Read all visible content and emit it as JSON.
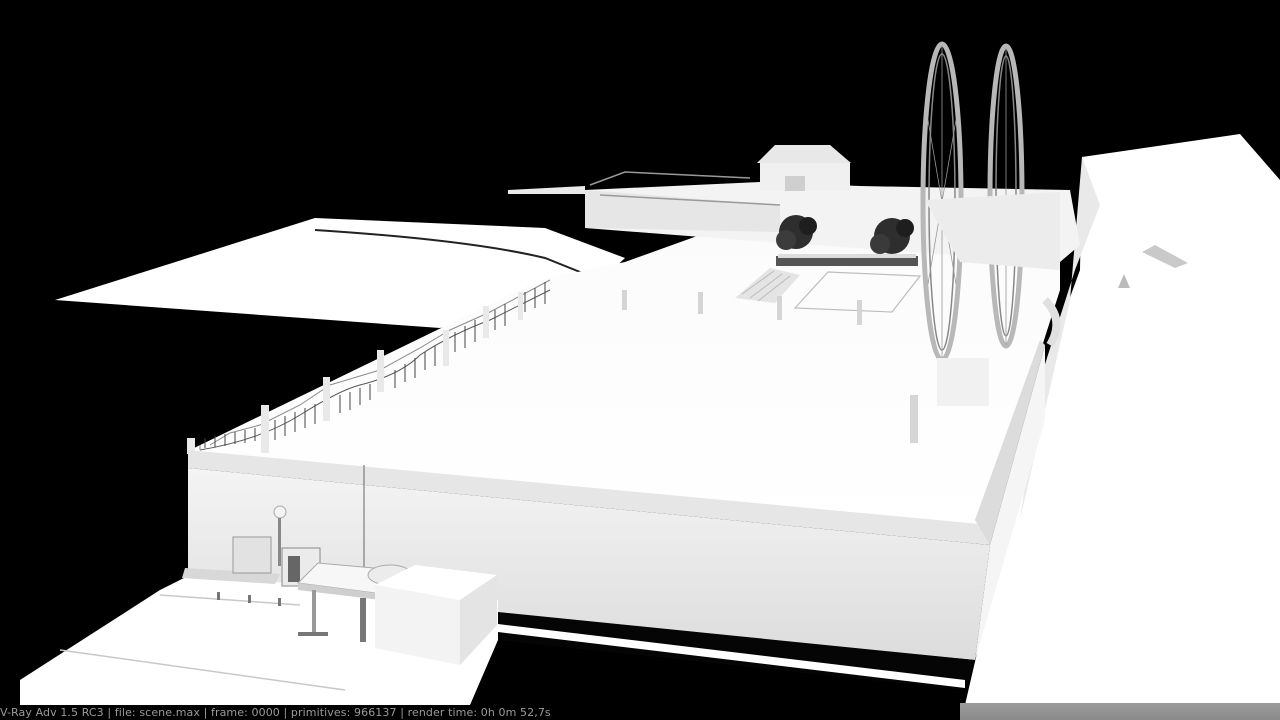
{
  "render_info": {
    "status_line": "V-Ray Adv 1.5 RC3 | file: scene.max | frame: 0000 | primitives: 966137 | render time: 0h 0m 52,7s"
  },
  "scene": {
    "description_icon": "clay-render-viewport",
    "colors": {
      "background": "#000000",
      "clay": "#ffffff",
      "shadow": "#d6d6d6",
      "statusbar_text": "#9a9a9a"
    }
  }
}
